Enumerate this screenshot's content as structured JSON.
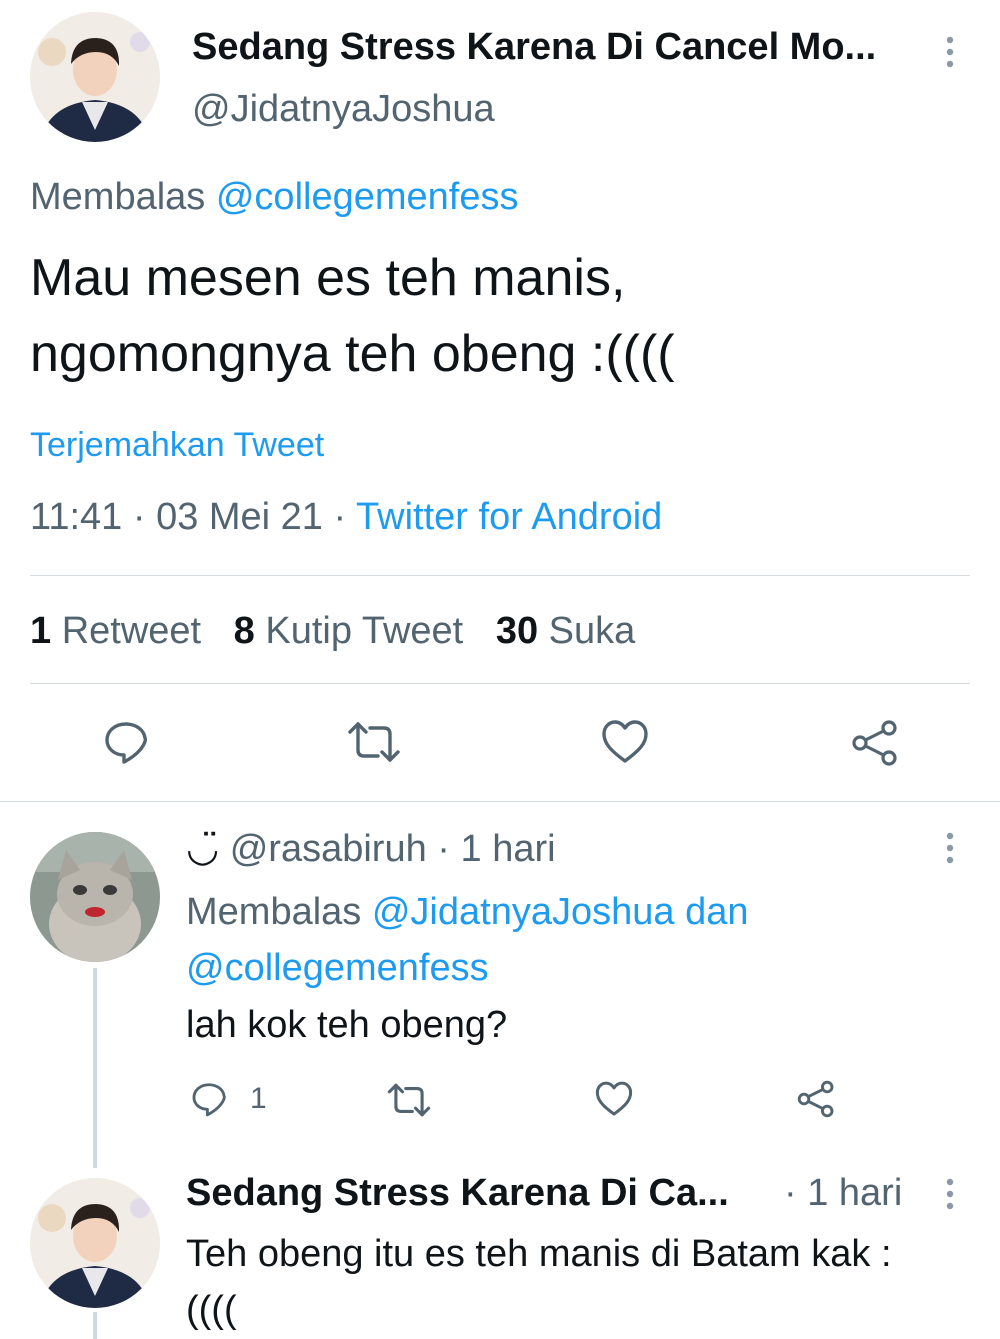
{
  "main_tweet": {
    "display_name": "Sedang Stress Karena Di Cancel Mo...",
    "handle": "@JidatnyaJoshua",
    "reply_prefix": "Membalas",
    "reply_to": "@collegemenfess",
    "text_line1": "Mau mesen es teh manis,",
    "text_line2": "ngomongnya teh obeng :((((",
    "translate": "Terjemahkan Tweet",
    "time": "11:41",
    "date": "03 Mei 21",
    "source": "Twitter for Android",
    "stats": {
      "retweets_count": "1",
      "retweets_label": "Retweet",
      "quotes_count": "8",
      "quotes_label": "Kutip Tweet",
      "likes_count": "30",
      "likes_label": "Suka"
    }
  },
  "reply1": {
    "emoji": "◡̈",
    "handle": "@rasabiruh",
    "time": "1 hari",
    "reply_prefix": "Membalas",
    "reply_to_1": "@JidatnyaJoshua",
    "reply_and": "dan",
    "reply_to_2": "@collegemenfess",
    "text": "lah kok teh obeng?",
    "reply_count": "1"
  },
  "reply2": {
    "display_name": "Sedang Stress Karena Di Ca...",
    "time": "1 hari",
    "text_line1": "Teh obeng itu es teh manis di Batam kak :",
    "text_line2": "(((("
  },
  "colors": {
    "accent": "#1d9bf0",
    "secondary_text": "#536471",
    "thread_line": "#cfd9de"
  }
}
